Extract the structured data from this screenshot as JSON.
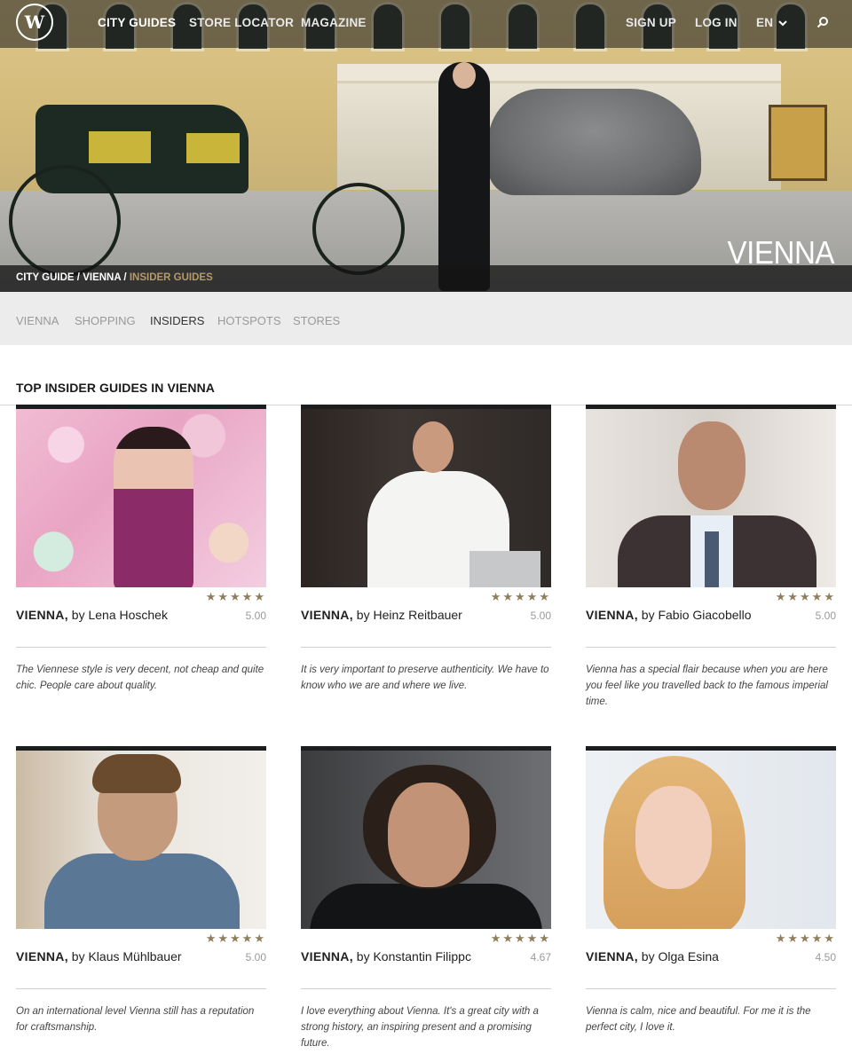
{
  "nav": {
    "logo_text": "W",
    "links": [
      "CITY GUIDES",
      "STORE LOCATOR",
      "MAGAZINE"
    ],
    "sign_up": "SIGN UP",
    "log_in": "LOG IN",
    "language": "EN",
    "search_icon": "search-icon"
  },
  "hero": {
    "city_title": "VIENNA",
    "breadcrumb": {
      "part1": "CITY GUIDE",
      "sep1": " / ",
      "part2": "VIENNA",
      "sep2": " / ",
      "current": "INSIDER GUIDES"
    }
  },
  "subnav": [
    "VIENNA",
    "SHOPPING",
    "INSIDERS",
    "HOTSPOTS",
    "STORES"
  ],
  "subnav_active": "INSIDERS",
  "section_title": "TOP INSIDER GUIDES IN VIENNA",
  "cards": [
    {
      "city": "VIENNA,",
      "author": " by Lena Hoschek",
      "stars": "★★★★★",
      "star_count": 5,
      "rating": "5.00",
      "quote": "The Viennese style is very decent, not cheap and quite chic. People care about quality."
    },
    {
      "city": "VIENNA,",
      "author": " by Heinz Reitbauer",
      "stars": "★★★★★",
      "star_count": 5,
      "rating": "5.00",
      "quote": "It is very important to preserve authenticity. We have to know who we are and where we live."
    },
    {
      "city": "VIENNA,",
      "author": " by Fabio Giacobello",
      "stars": "★★★★★",
      "star_count": 5,
      "rating": "5.00",
      "quote": "Vienna has a special flair because when you are here you feel like you travelled back to the famous imperial time."
    },
    {
      "city": "VIENNA,",
      "author": " by Klaus Mühlbauer",
      "stars": "★★★★★",
      "star_count": 5,
      "rating": "5.00",
      "quote": "On an international level Vienna still has a reputation for craftsmanship."
    },
    {
      "city": "VIENNA,",
      "author": " by Konstantin Filippc",
      "stars": "★★★★★",
      "star_count": 5,
      "rating": "4.67",
      "quote": "I love everything about Vienna. It's a great city with a strong history, an inspiring present and a promising future."
    },
    {
      "city": "VIENNA,",
      "author": " by Olga Esina",
      "stars": "★★★★★",
      "star_count": 5,
      "rating": "4.50",
      "quote": "Vienna is calm, nice and beautiful. For me it is the perfect city, I love it."
    }
  ],
  "colors": {
    "accent_gold": "#b59a6a",
    "star": "#8f7e5e",
    "subnav_bg": "#ececec"
  }
}
